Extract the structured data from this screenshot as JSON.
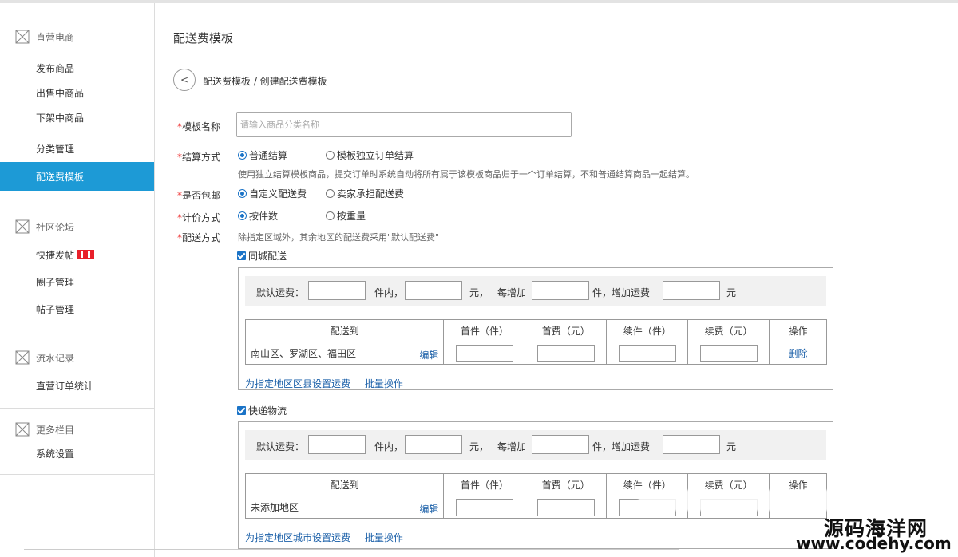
{
  "sidebar": {
    "sections": [
      {
        "title": "直营电商",
        "items": [
          "发布商品",
          "出售中商品",
          "下架中商品",
          "分类管理",
          "配送费模板"
        ]
      },
      {
        "title": "社区论坛",
        "items": [
          "快捷发帖",
          "圈子管理",
          "帖子管理"
        ]
      },
      {
        "title": "流水记录",
        "items": [
          "直营订单统计"
        ]
      },
      {
        "title": "更多栏目",
        "items": [
          "系统设置"
        ]
      }
    ],
    "active_item": "配送费模板"
  },
  "page": {
    "title": "配送费模板",
    "back_label": "<",
    "breadcrumb": "配送费模板 / 创建配送费模板"
  },
  "form": {
    "name_label": "模板名称",
    "name_placeholder": "请输入商品分类名称",
    "settle_label": "结算方式",
    "settle_opt1": "普通结算",
    "settle_opt2": "模板独立订单结算",
    "settle_hint": "使用独立结算模板商品，提交订单时系统自动将所有属于该模板商品归于一个订单结算，不和普通结算商品一起结算。",
    "free_label": "是否包邮",
    "free_opt1": "自定义配送费",
    "free_opt2": "卖家承担配送费",
    "price_label": "计价方式",
    "price_opt1": "按件数",
    "price_opt2": "按重量",
    "delivery_label": "配送方式",
    "delivery_hint": "除指定区域外，其余地区的配送费采用\"默认配送费\"",
    "required_mark": "*"
  },
  "fee_bar": {
    "default_fee": "默认运费：",
    "pieces_within": "件内，",
    "yuan_comma": "元，",
    "each_add": "每增加",
    "pieces_add_fee": "件，增加运费",
    "yuan": "元"
  },
  "table_headers": [
    "配送到",
    "首件（件）",
    "首费（元）",
    "续件（件）",
    "续费（元）",
    "操作"
  ],
  "local": {
    "checkbox_label": "同城配送",
    "rows": [
      {
        "region": "南山区、罗湖区、福田区",
        "edit": "编辑",
        "action": "删除"
      }
    ],
    "link1": "为指定地区区县设置运费",
    "link2": "批量操作"
  },
  "express": {
    "checkbox_label": "快递物流",
    "rows": [
      {
        "region": "未添加地区",
        "edit": "编辑"
      }
    ],
    "link1": "为指定地区城市设置运费",
    "link2": "批量操作"
  },
  "watermark": {
    "name": "源码海洋网",
    "url": "www.codehy.com"
  }
}
